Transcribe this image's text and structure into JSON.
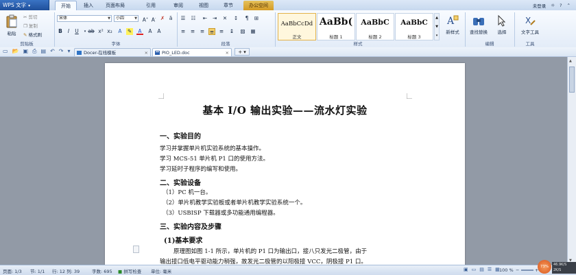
{
  "app": {
    "menu_label": "WPS 文字",
    "login_label": "未登录"
  },
  "ribbon_tabs": [
    "开始",
    "插入",
    "页面布局",
    "引用",
    "审阅",
    "视图",
    "章节",
    "办公空间"
  ],
  "clipboard": {
    "paste": "粘贴",
    "cut": "剪切",
    "copy": "复制",
    "format_painter": "格式刷",
    "group": "剪贴板"
  },
  "font": {
    "name": "宋体",
    "size": "小四",
    "group": "字体"
  },
  "paragraph": {
    "group": "段落"
  },
  "styles": {
    "group": "样式",
    "items": [
      {
        "sample": "AaBbCcDd",
        "name": "正文"
      },
      {
        "sample": "AaBb(",
        "name": "标题 1"
      },
      {
        "sample": "AaBbC",
        "name": "标题 2"
      },
      {
        "sample": "AaBbC",
        "name": "标题 3"
      }
    ],
    "new_style": "新样式"
  },
  "editing": {
    "find_replace": "查找替换",
    "select": "选择",
    "group": "编辑"
  },
  "tools": {
    "text_tools": "文字工具",
    "group": "工具"
  },
  "doc_tabs": [
    {
      "label": "Docer-在线模板"
    },
    {
      "label": "PIO_LED.doc"
    }
  ],
  "document": {
    "title": "基本 I/O 输出实验——流水灯实验",
    "sections": [
      {
        "heading": "一、实验目的"
      },
      {
        "heading": "二、实验设备"
      },
      {
        "heading": "三、实验内容及步骤"
      }
    ],
    "lines_purpose": [
      "学习并掌握单片机实验系统的基本操作。",
      "学习 MCS-51 单片机 P1 口的使用方法。",
      "学习延时子程序的编写和使用。"
    ],
    "lines_equipment": [
      "（1）PC 机一台。",
      "（2）单片机教学实验板或者单片机教学实验系统一个。",
      "（3）USBISP 下载器或多功能通用编程器。"
    ],
    "subheading": "(1)基本要求",
    "body_lines": [
      "原理图如图 1-1 所示，单片机的 P1 口为输出口，接八只发光二极管，由于",
      "输出接口低电平驱动能力稍强，故发光二极管的以阳极接 VCC，阴极接 P1 口。"
    ]
  },
  "status": {
    "page": "页面: 1/3",
    "section": "节: 1/1",
    "row_col": "行: 12  列: 39",
    "word_count": "字数: 695",
    "spell_check": "拼写检查",
    "unit": "单位: 毫米",
    "zoom": "100 %",
    "net_percent": "73%",
    "net_up": "46.9K/S",
    "net_down": "2K/S"
  },
  "colors": {
    "accent": "#1f4f9a",
    "ribbon": "#e3ecf8",
    "workspace": "#929aa6",
    "special_tab": "#d39a25"
  }
}
